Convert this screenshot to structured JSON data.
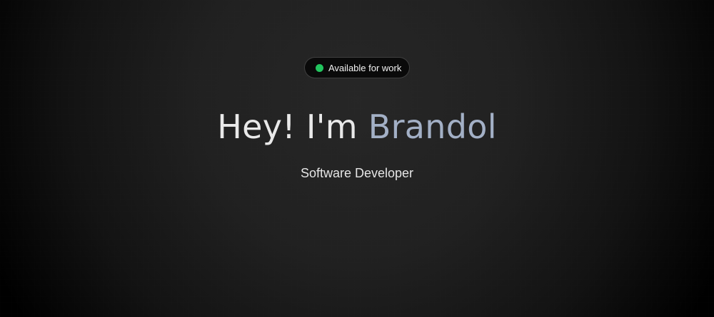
{
  "status_badge": {
    "label": "Available for work",
    "dot_color": "#22c55e"
  },
  "headline": {
    "greeting": "Hey! I'm ",
    "name": "Brandol"
  },
  "subtitle": "Software Developer",
  "colors": {
    "background": "#000000",
    "name_accent": "#a3b0c6",
    "text": "#e9e9e9"
  }
}
